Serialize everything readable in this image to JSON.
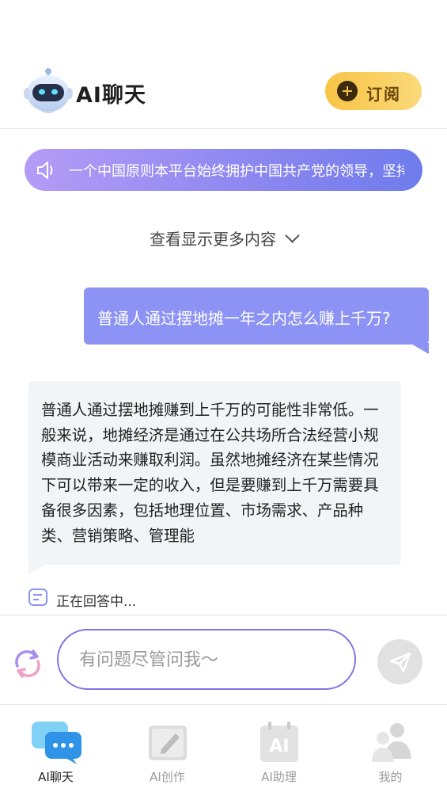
{
  "header": {
    "app_title": "AI聊天",
    "subscribe_label": "订阅"
  },
  "notice": {
    "text": "一个中国原则本平台始终拥护中国共产党的领导，坚持"
  },
  "show_more_label": "查看显示更多内容",
  "messages": [
    {
      "role": "user",
      "text": "普通人通过摆地摊一年之内怎么赚上千万?"
    },
    {
      "role": "ai",
      "text": "普通人通过摆地摊赚到上千万的可能性非常低。一般来说，地摊经济是通过在公共场所合法经营小规模商业活动来赚取利润。虽然地摊经济在某些情况下可以带来一定的收入，但是要赚到上千万需要具备很多因素，包括地理位置、市场需求、产品种类、营销策略、管理能"
    }
  ],
  "status_text": "正在回答中...",
  "input": {
    "placeholder": "有问题尽管问我～",
    "value": ""
  },
  "tabs": [
    {
      "label": "AI聊天",
      "icon": "chat-bubbles-icon",
      "active": true
    },
    {
      "label": "AI创作",
      "icon": "notebook-pen-icon",
      "active": false
    },
    {
      "label": "AI助理",
      "icon": "ai-calendar-icon",
      "active": false
    },
    {
      "label": "我的",
      "icon": "users-icon",
      "active": false
    }
  ],
  "colors": {
    "accent": "#8c93f4",
    "subscribe_bg": "#f8c445",
    "notice_gradient_start": "#b39cf6",
    "notice_gradient_end": "#6f7cec"
  }
}
